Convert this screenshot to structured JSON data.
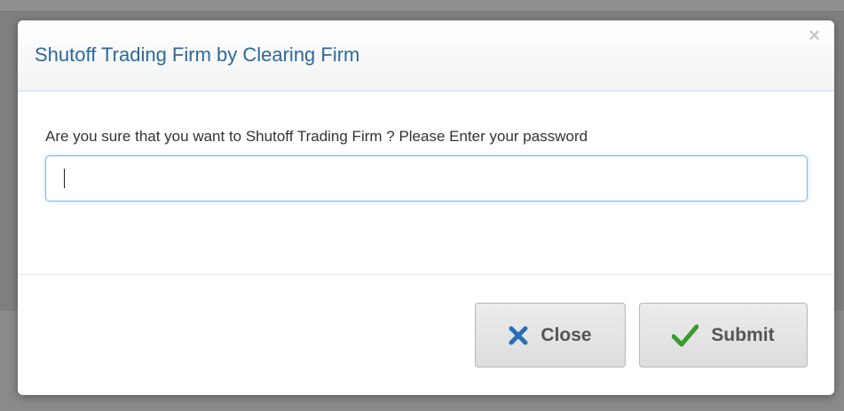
{
  "dialog": {
    "title": "Shutoff Trading Firm by Clearing Firm",
    "close_glyph": "×",
    "prompt": "Are you sure that you want to Shutoff Trading Firm ? Please Enter your password",
    "password_field": {
      "value": "",
      "placeholder": ""
    },
    "buttons": {
      "close_label": "Close",
      "submit_label": "Submit"
    },
    "icons": {
      "close": "x-icon",
      "submit": "check-icon"
    },
    "colors": {
      "title": "#2c6a99",
      "close_icon": "#2a6fb6",
      "submit_icon": "#3a9a2e",
      "input_focus_border": "#8fb8dc"
    }
  }
}
